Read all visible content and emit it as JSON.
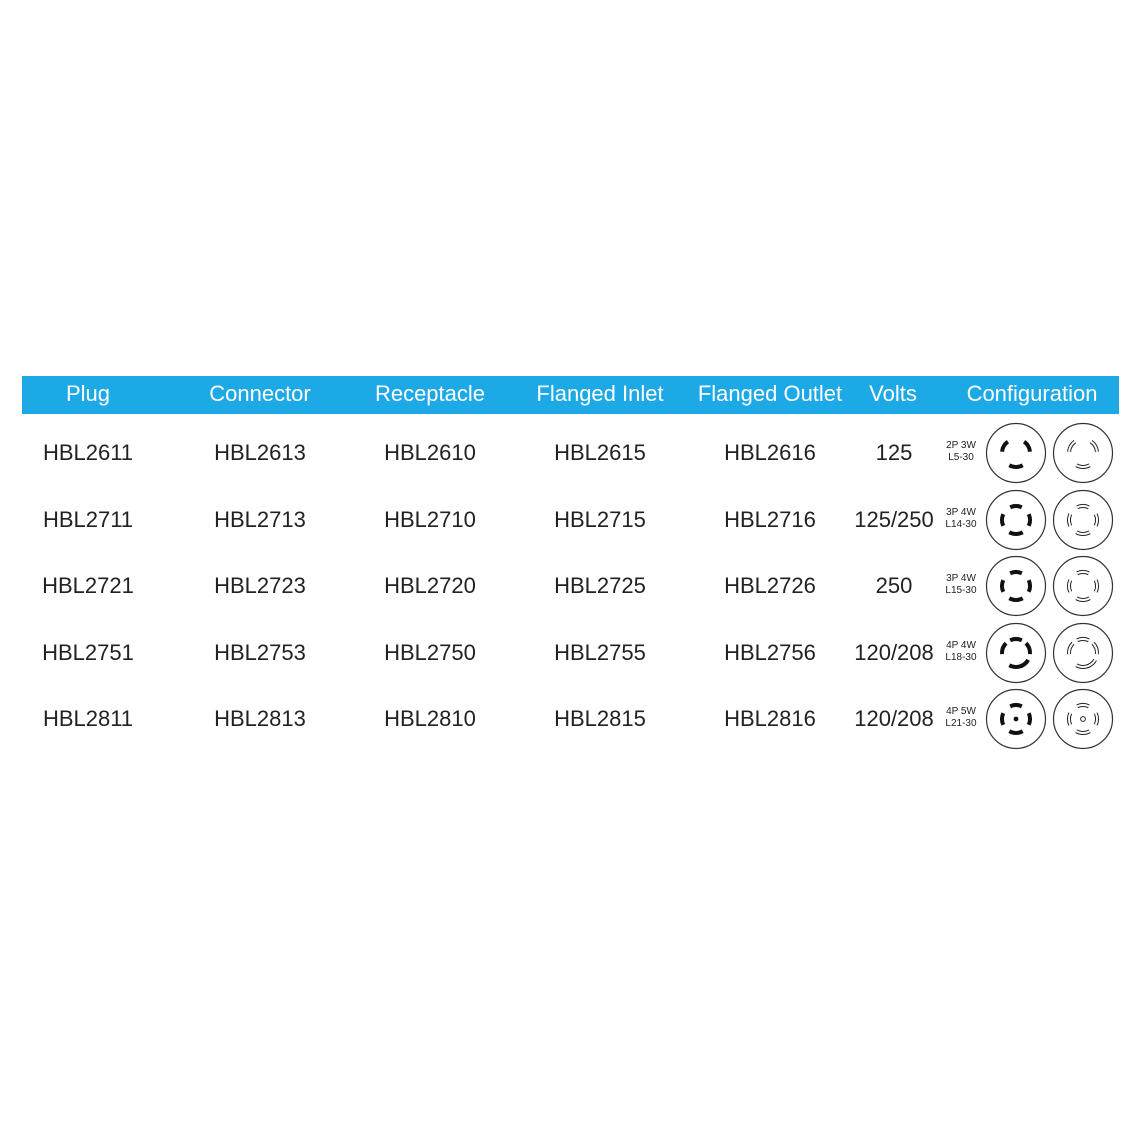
{
  "table": {
    "headers": {
      "plug": "Plug",
      "connector": "Connector",
      "receptacle": "Receptacle",
      "flanged_inlet": "Flanged Inlet",
      "flanged_outlet": "Flanged Outlet",
      "volts": "Volts",
      "configuration": "Configuration"
    },
    "header_color": "#1da9e6",
    "rows": [
      {
        "plug": "HBL2611",
        "connector": "HBL2613",
        "receptacle": "HBL2610",
        "flanged_inlet": "HBL2615",
        "flanged_outlet": "HBL2616",
        "volts": "125",
        "config_poles": "2P 3W",
        "config_nema": "L5-30",
        "receptacle_face_icon": "nema-l5-30-receptacle-face-icon",
        "plug_face_icon": "nema-l5-30-plug-face-icon"
      },
      {
        "plug": "HBL2711",
        "connector": "HBL2713",
        "receptacle": "HBL2710",
        "flanged_inlet": "HBL2715",
        "flanged_outlet": "HBL2716",
        "volts": "125/250",
        "config_poles": "3P 4W",
        "config_nema": "L14-30",
        "receptacle_face_icon": "nema-l14-30-receptacle-face-icon",
        "plug_face_icon": "nema-l14-30-plug-face-icon"
      },
      {
        "plug": "HBL2721",
        "connector": "HBL2723",
        "receptacle": "HBL2720",
        "flanged_inlet": "HBL2725",
        "flanged_outlet": "HBL2726",
        "volts": "250",
        "config_poles": "3P 4W",
        "config_nema": "L15-30",
        "receptacle_face_icon": "nema-l15-30-receptacle-face-icon",
        "plug_face_icon": "nema-l15-30-plug-face-icon"
      },
      {
        "plug": "HBL2751",
        "connector": "HBL2753",
        "receptacle": "HBL2750",
        "flanged_inlet": "HBL2755",
        "flanged_outlet": "HBL2756",
        "volts": "120/208",
        "config_poles": "4P 4W",
        "config_nema": "L18-30",
        "receptacle_face_icon": "nema-l18-30-receptacle-face-icon",
        "plug_face_icon": "nema-l18-30-plug-face-icon"
      },
      {
        "plug": "HBL2811",
        "connector": "HBL2813",
        "receptacle": "HBL2810",
        "flanged_inlet": "HBL2815",
        "flanged_outlet": "HBL2816",
        "volts": "120/208",
        "config_poles": "4P 5W",
        "config_nema": "L21-30",
        "receptacle_face_icon": "nema-l21-30-receptacle-face-icon",
        "plug_face_icon": "nema-l21-30-plug-face-icon"
      }
    ]
  }
}
